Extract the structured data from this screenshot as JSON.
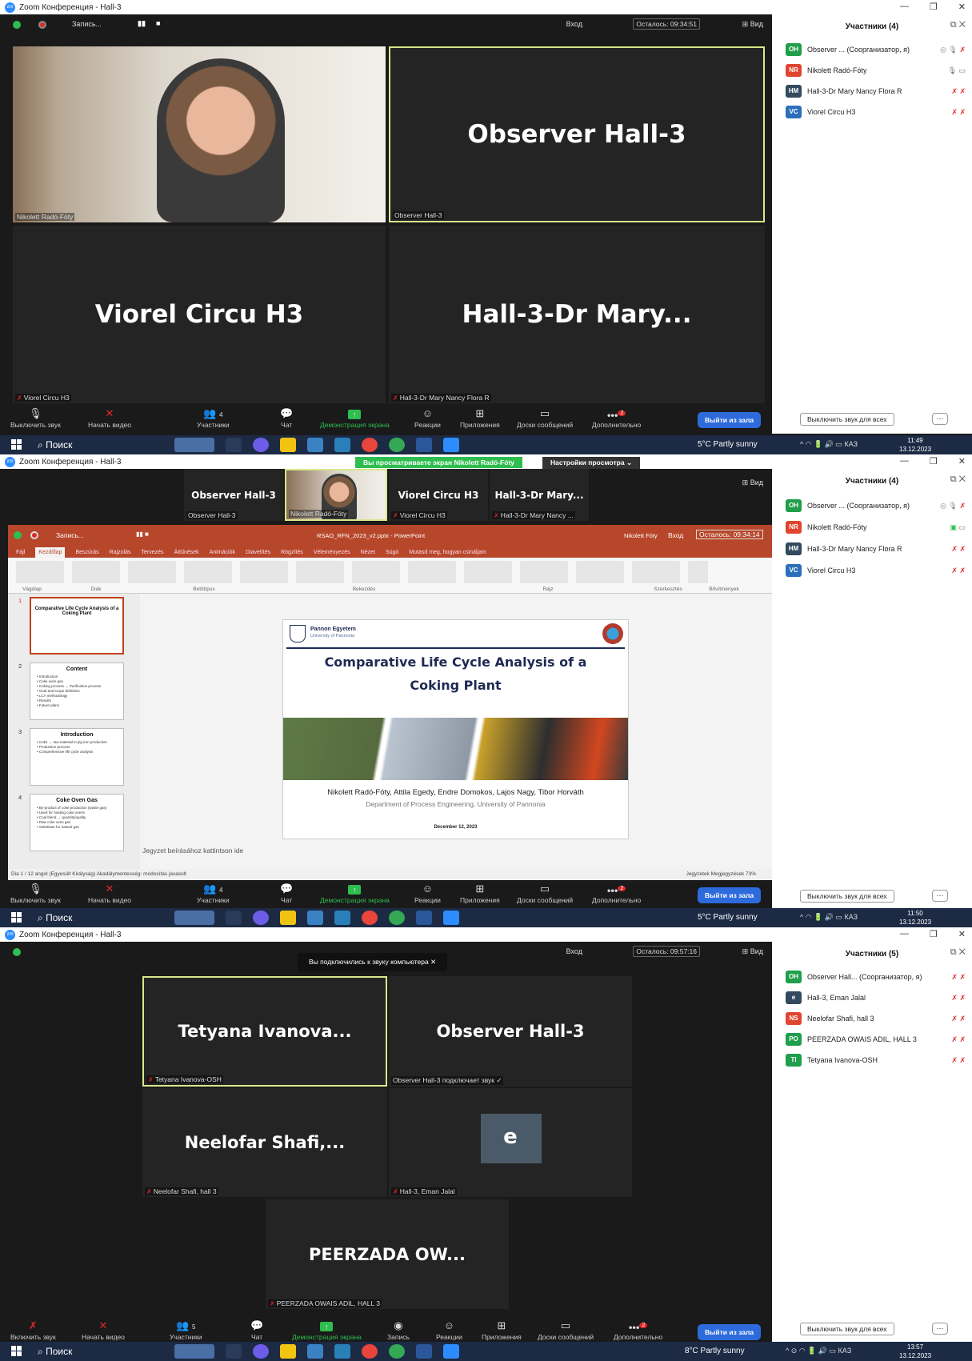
{
  "app_title": "Zoom Конференция - Hall-3",
  "recording_label": "Запись...",
  "enter_label": "Вход",
  "view_label": "Вид",
  "controls": {
    "mute_label": "Выключить звук",
    "unmute_label": "Включить звук",
    "video_label": "Начать видео",
    "participants_label": "Участники",
    "chat_label": "Чат",
    "share_label": "Демонстрация экрана",
    "reactions_label": "Реакции",
    "apps_label": "Приложения",
    "boards_label": "Доски сообщений",
    "more_label": "Дополнительно",
    "record_label": "Запись",
    "leave_label": "Выйти из зала",
    "more_badge": "2"
  },
  "panel": {
    "mute_all_label": "Выключить звук для всех",
    "more_btn": "···"
  },
  "taskbar": {
    "search_label": "Поиск",
    "lang": "КАЗ"
  },
  "shot1": {
    "remaining": "Осталось: 09:34:51",
    "participants_count": "4",
    "tiles": [
      {
        "big": "",
        "name": "Nikolett Radó-Fóty"
      },
      {
        "big": "Observer  Hall-3",
        "name": "Observer  Hall-3"
      },
      {
        "big": "Viorel Circu H3",
        "name": "Viorel Circu H3"
      },
      {
        "big": "Hall-3-Dr  Mary...",
        "name": "Hall-3-Dr Mary Nancy Flora R"
      }
    ],
    "panel_title": "Участники (4)",
    "people": [
      {
        "initials": "OH",
        "color": "#1f9e4b",
        "name": "Observer ... (Соорганизатор, я)"
      },
      {
        "initials": "NR",
        "color": "#e0452f",
        "name": "Nikolett Radó-Fóty"
      },
      {
        "initials": "HM",
        "color": "#33495f",
        "name": "Hall-3-Dr Mary Nancy Flora R"
      },
      {
        "initials": "VC",
        "color": "#2b6fba",
        "name": "Viorel Circu H3"
      }
    ],
    "weather": "5°C  Partly sunny",
    "time": "11:49",
    "date": "13.12.2023"
  },
  "shot2": {
    "banner": "Вы просматриваете экран Nikolett Radó-Fóty",
    "view_options": "Настройки просмотра  ⌄",
    "strip": [
      {
        "big": "Observer  Hall-3",
        "name": "Observer  Hall-3"
      },
      {
        "big": "",
        "name": "Nikolett Radó-Fóty"
      },
      {
        "big": "Viorel Circu H3",
        "name": "Viorel Circu H3"
      },
      {
        "big": "Hall-3-Dr  Mary...",
        "name": "Hall-3-Dr Mary Nancy ..."
      }
    ],
    "remaining": "Осталось: 09:34:14",
    "ppt_filename": "RSAO_RFN_2023_v2.pptx - PowerPoint",
    "ppt_user": "Nikolett Fóty",
    "ppt_menu": [
      "Fájl",
      "Kezdőlap",
      "Beszúrás",
      "Rajzolás",
      "Tervezés",
      "Áttűnések",
      "Animációk",
      "Diavetítés",
      "Rögzítés",
      "Véleményezés",
      "Nézet",
      "Súgó",
      "Mutasd meg, hogyan csináljam"
    ],
    "ppt_groups": [
      "Vágólap",
      "Diák",
      "Betűtípus",
      "Bekezdés",
      "Rajz",
      "Szerkesztés",
      "Bővítmények"
    ],
    "thumbs": [
      {
        "num": "1",
        "title": "Comparative Life Cycle Analysis of a Coking Plant",
        "lines": []
      },
      {
        "num": "2",
        "title": "Content",
        "lines": [
          "• Introduction",
          "• Coke oven gas",
          "• Coking process → Purification process",
          "• Goal and scope definition",
          "• LCA methodology",
          "• Results",
          "• Future plans"
        ]
      },
      {
        "num": "3",
        "title": "Introduction",
        "lines": [
          "• Coke → raw material in pig iron production",
          "• Production process",
          "• Comprehensive life cycle analysis"
        ]
      },
      {
        "num": "4",
        "title": "Coke Oven Gas",
        "lines": [
          "• By-product of coke production (waste gas)",
          "• Used for heating coke ovens",
          "• Coal blend → quantity/quality",
          "• Raw coke oven gas",
          "• Substitute for natural gas"
        ]
      }
    ],
    "slide": {
      "uni": "Pannon Egyetem",
      "uni_sub": "University of Pannonia",
      "title_line1": "Comparative Life Cycle Analysis of a",
      "title_line2": "Coking Plant",
      "authors": "Nikolett Radó-Fóty, Attila Egedy, Endre Domokos, Lajos Nagy, Tibor Horváth",
      "dept": "Department of Process Engineering, University of Pannonia",
      "date": "December 12, 2023"
    },
    "notes_placeholder": "Jegyzet beírásához kattintson ide",
    "status_left": "Dia 1 / 12    angol (Egyesült Királyság)    Akadálymentesség: módosítás javasolt",
    "status_right": "Jegyzetek   Megjegyzések          73%",
    "panel_title": "Участники (4)",
    "people": [
      {
        "initials": "OH",
        "color": "#1f9e4b",
        "name": "Observer ... (Соорганизатор, я)"
      },
      {
        "initials": "NR",
        "color": "#e0452f",
        "name": "Nikolett Radó-Fóty"
      },
      {
        "initials": "HM",
        "color": "#33495f",
        "name": "Hall-3-Dr Mary Nancy Flora R"
      },
      {
        "initials": "VC",
        "color": "#2b6fba",
        "name": "Viorel Circu H3"
      }
    ],
    "weather": "5°C  Partly sunny",
    "time": "11:50",
    "date": "13.12.2023"
  },
  "shot3": {
    "remaining": "Осталось: 09:57:16",
    "toast": "Вы подключились к звуку компьютера   ✕",
    "participants_count": "5",
    "tiles": [
      {
        "big": "Tetyana  Ivanova...",
        "name": "Tetyana Ivanova-OSH"
      },
      {
        "big": "Observer  Hall-3",
        "name": "Observer  Hall-3 подключает звук ✓"
      },
      {
        "big": "Neelofar  Shafi,...",
        "name": "Neelofar Shafi, hall 3"
      },
      {
        "big": "e",
        "name": "Hall-3, Eman Jalal"
      },
      {
        "big": "PEERZADA  OW...",
        "name": "PEERZADA OWAIS ADIL, HALL 3"
      }
    ],
    "panel_title": "Участники (5)",
    "people": [
      {
        "initials": "OH",
        "color": "#1f9e4b",
        "name": "Observer  Hall... (Соорганизатор, я)"
      },
      {
        "initials": "e",
        "color": "#33495f",
        "name": "Hall-3, Eman Jalal"
      },
      {
        "initials": "NS",
        "color": "#e0452f",
        "name": "Neelofar Shafi, hall 3"
      },
      {
        "initials": "PO",
        "color": "#1f9e4b",
        "name": "PEERZADA OWAIS ADIL, HALL 3"
      },
      {
        "initials": "TI",
        "color": "#1f9e4b",
        "name": "Tetyana Ivanova-OSH"
      }
    ],
    "weather": "8°C  Partly sunny",
    "time": "13:57",
    "date": "13.12.2023"
  }
}
